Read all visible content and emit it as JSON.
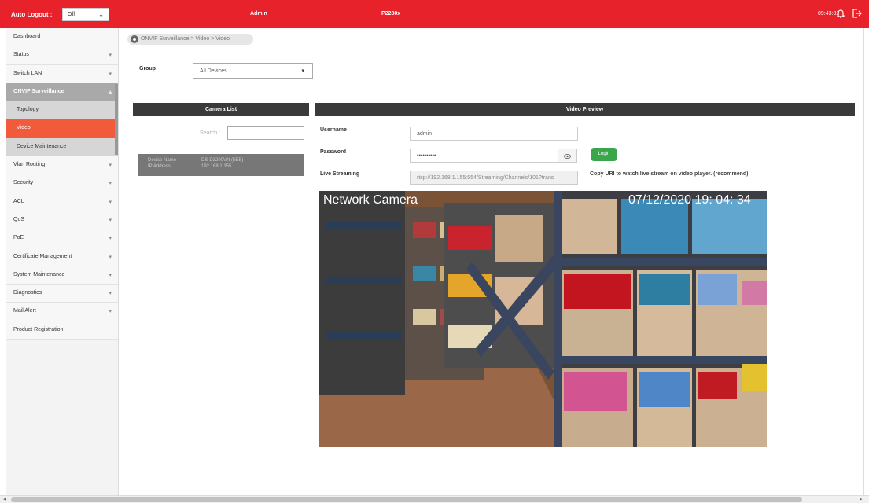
{
  "topbar": {
    "auto_logout_label": "Auto Logout :",
    "auto_logout_value": "Off",
    "user": "Admin",
    "model": "P2280x",
    "time": "09:43:02",
    "bell_icon": "bell-icon",
    "logout_icon": "logout-icon"
  },
  "sidebar": {
    "items": [
      {
        "label": "Dashboard",
        "chevron": ""
      },
      {
        "label": "Status",
        "chevron": "▾"
      },
      {
        "label": "Switch LAN",
        "chevron": "▾"
      },
      {
        "label": "ONVIF Surveillance",
        "chevron": "▴"
      },
      {
        "label": "Topology",
        "chevron": ""
      },
      {
        "label": "Video",
        "chevron": ""
      },
      {
        "label": "Device Maintenance",
        "chevron": ""
      },
      {
        "label": "Vlan Routing",
        "chevron": "▾"
      },
      {
        "label": "Security",
        "chevron": "▾"
      },
      {
        "label": "ACL",
        "chevron": "▾"
      },
      {
        "label": "QoS",
        "chevron": "▾"
      },
      {
        "label": "PoE",
        "chevron": "▾"
      },
      {
        "label": "Certificate Management",
        "chevron": "▾"
      },
      {
        "label": "System Maintenance",
        "chevron": "▾"
      },
      {
        "label": "Diagnostics",
        "chevron": "▾"
      },
      {
        "label": "Mail Alert",
        "chevron": "▾"
      },
      {
        "label": "Product Registration",
        "chevron": ""
      }
    ]
  },
  "breadcrumb": "ONVIF Surveillance > Video > Video",
  "group": {
    "label": "Group",
    "value": "All Devices"
  },
  "camera_list": {
    "title": "Camera List",
    "search_label": "Search :",
    "device_name_key": "Device Name",
    "device_name_value": "DS-D3200VN (5EB)",
    "ip_key": "IP Address",
    "ip_value": "192.168.1.155"
  },
  "video_preview": {
    "title": "Video Preview",
    "username_label": "Username",
    "username_value": "admin",
    "password_label": "Password",
    "password_value": "••••••••••",
    "login_label": "Login",
    "live_label": "Live Streaming",
    "live_value": "rtsp://192.168.1.155:554/Streaming/Channels/101?trans",
    "copy_note": "Copy URI to watch live stream on video player. (recommend)",
    "overlay_name": "Network Camera",
    "overlay_datetime": "07/12/2020  19: 04: 34"
  }
}
